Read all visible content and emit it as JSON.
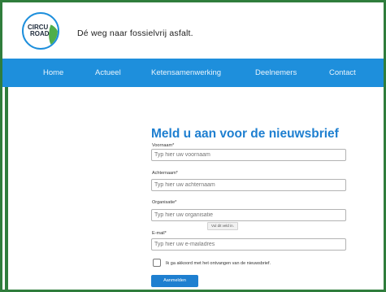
{
  "header": {
    "logo_text_line1": "CIRCU",
    "logo_text_line2": "ROAD",
    "tagline": "Dé weg naar fossielvrij asfalt."
  },
  "nav": {
    "items": [
      "Home",
      "Actueel",
      "Ketensamenwerking",
      "Deelnemers",
      "Contact"
    ]
  },
  "form": {
    "title": "Meld u aan voor de nieuwsbrief",
    "fields": [
      {
        "label": "Voornaam*",
        "placeholder": "Typ hier uw voornaam",
        "value": ""
      },
      {
        "label": "Achternaam*",
        "placeholder": "Typ hier uw achternaam",
        "value": ""
      },
      {
        "label": "Organisatie*",
        "placeholder": "Typ hier uw organisatie",
        "value": ""
      },
      {
        "label": "E-mail*",
        "placeholder": "Typ hier uw e-mailadres",
        "value": ""
      }
    ],
    "tooltip": "Vul dit veld in.",
    "consent_label": "Ik ga akkoord met het ontvangen van de nieuwsbrief.",
    "submit_label": "Aanmelden"
  },
  "colors": {
    "brand_blue": "#1e8fdc",
    "title_blue": "#1e7fd0",
    "frame_green": "#2f7d3c",
    "leaf_green": "#4fae4a"
  }
}
